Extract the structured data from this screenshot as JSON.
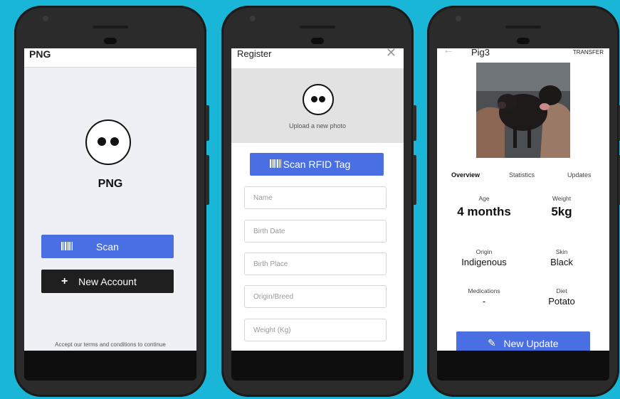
{
  "colors": {
    "background": "#19b6d8",
    "accent": "#4a6fe3",
    "dark_button": "#1f1f1f"
  },
  "phone1": {
    "header_title": "PNG",
    "app_name": "PNG",
    "scan_icon": "barcode-icon",
    "scan_label": "Scan",
    "new_account_icon": "plus-icon",
    "new_account_label": "New Account",
    "terms_text": "Accept our terms and conditions to continue"
  },
  "phone2": {
    "header_title": "Register",
    "close_icon": "close-icon",
    "upload_text": "Upload a new photo",
    "scan_rfid_label": "Scan RFID Tag",
    "fields": {
      "name": "Name",
      "birth_date": "Birth Date",
      "birth_place": "Birth Place",
      "origin_breed": "Origin/Breed",
      "weight": "Weight (Kg)"
    }
  },
  "phone3": {
    "back_icon": "back-arrow-icon",
    "header_title": "Pig3",
    "transfer_label": "TRANSFER",
    "tabs": {
      "overview": "Overview",
      "statistics": "Statistics",
      "updates": "Updates"
    },
    "stats": {
      "age_label": "Age",
      "age_value": "4 months",
      "weight_label": "Weight",
      "weight_value": "5kg",
      "origin_label": "Origin",
      "origin_value": "Indigenous",
      "skin_label": "Skin",
      "skin_value": "Black",
      "medications_label": "Medications",
      "medications_value": "-",
      "diet_label": "Diet",
      "diet_value": "Potato"
    },
    "new_update_icon": "edit-icon",
    "new_update_label": "New Update"
  }
}
